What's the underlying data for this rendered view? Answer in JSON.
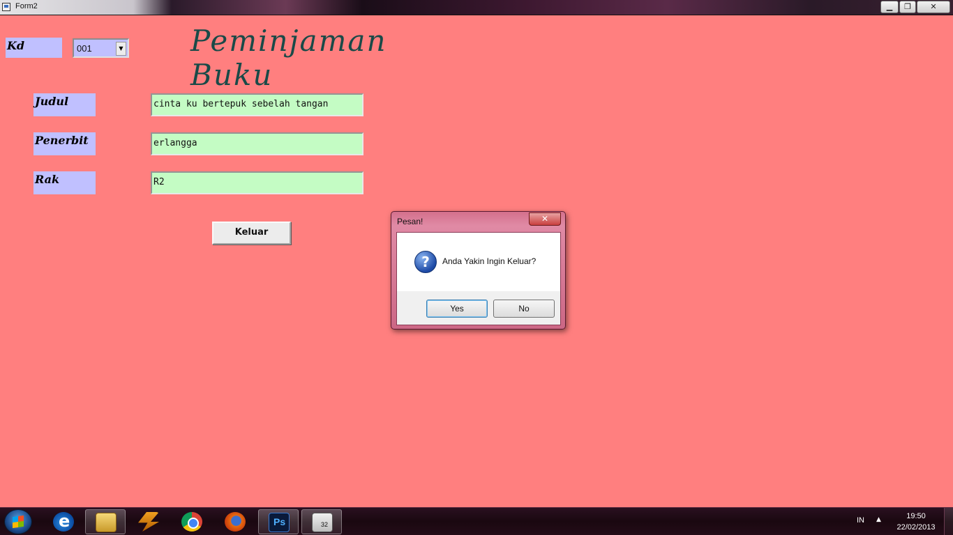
{
  "window": {
    "title": "Form2",
    "min_label": "▁",
    "max_label": "❐",
    "close_label": "✕"
  },
  "form": {
    "heading": "Peminjaman Buku",
    "kd_label": "Kd",
    "kd_value": "001",
    "judul_label": "Judul",
    "judul_value": "cinta ku bertepuk sebelah tangan",
    "penerbit_label": "Penerbit",
    "penerbit_value": "erlangga",
    "rak_label": "Rak",
    "rak_value": "R2",
    "keluar_button": "Keluar"
  },
  "dialog": {
    "title": "Pesan!",
    "close_label": "✕",
    "icon": "question-icon",
    "message": "Anda Yakin Ingin Keluar?",
    "yes_label": "Yes",
    "no_label": "No"
  },
  "taskbar": {
    "items": [
      "start-button",
      "internet-explorer-icon",
      "windows-explorer-icon",
      "winamp-icon",
      "chrome-icon",
      "firefox-icon",
      "photoshop-icon",
      "vb6-app-icon"
    ],
    "language": "IN",
    "time": "19:50",
    "date": "22/02/2013"
  },
  "colors": {
    "form_background": "#ff7f7f",
    "label_background": "#c0c0ff",
    "field_background": "#c4fcc4",
    "heading_color": "#1a4a48"
  }
}
